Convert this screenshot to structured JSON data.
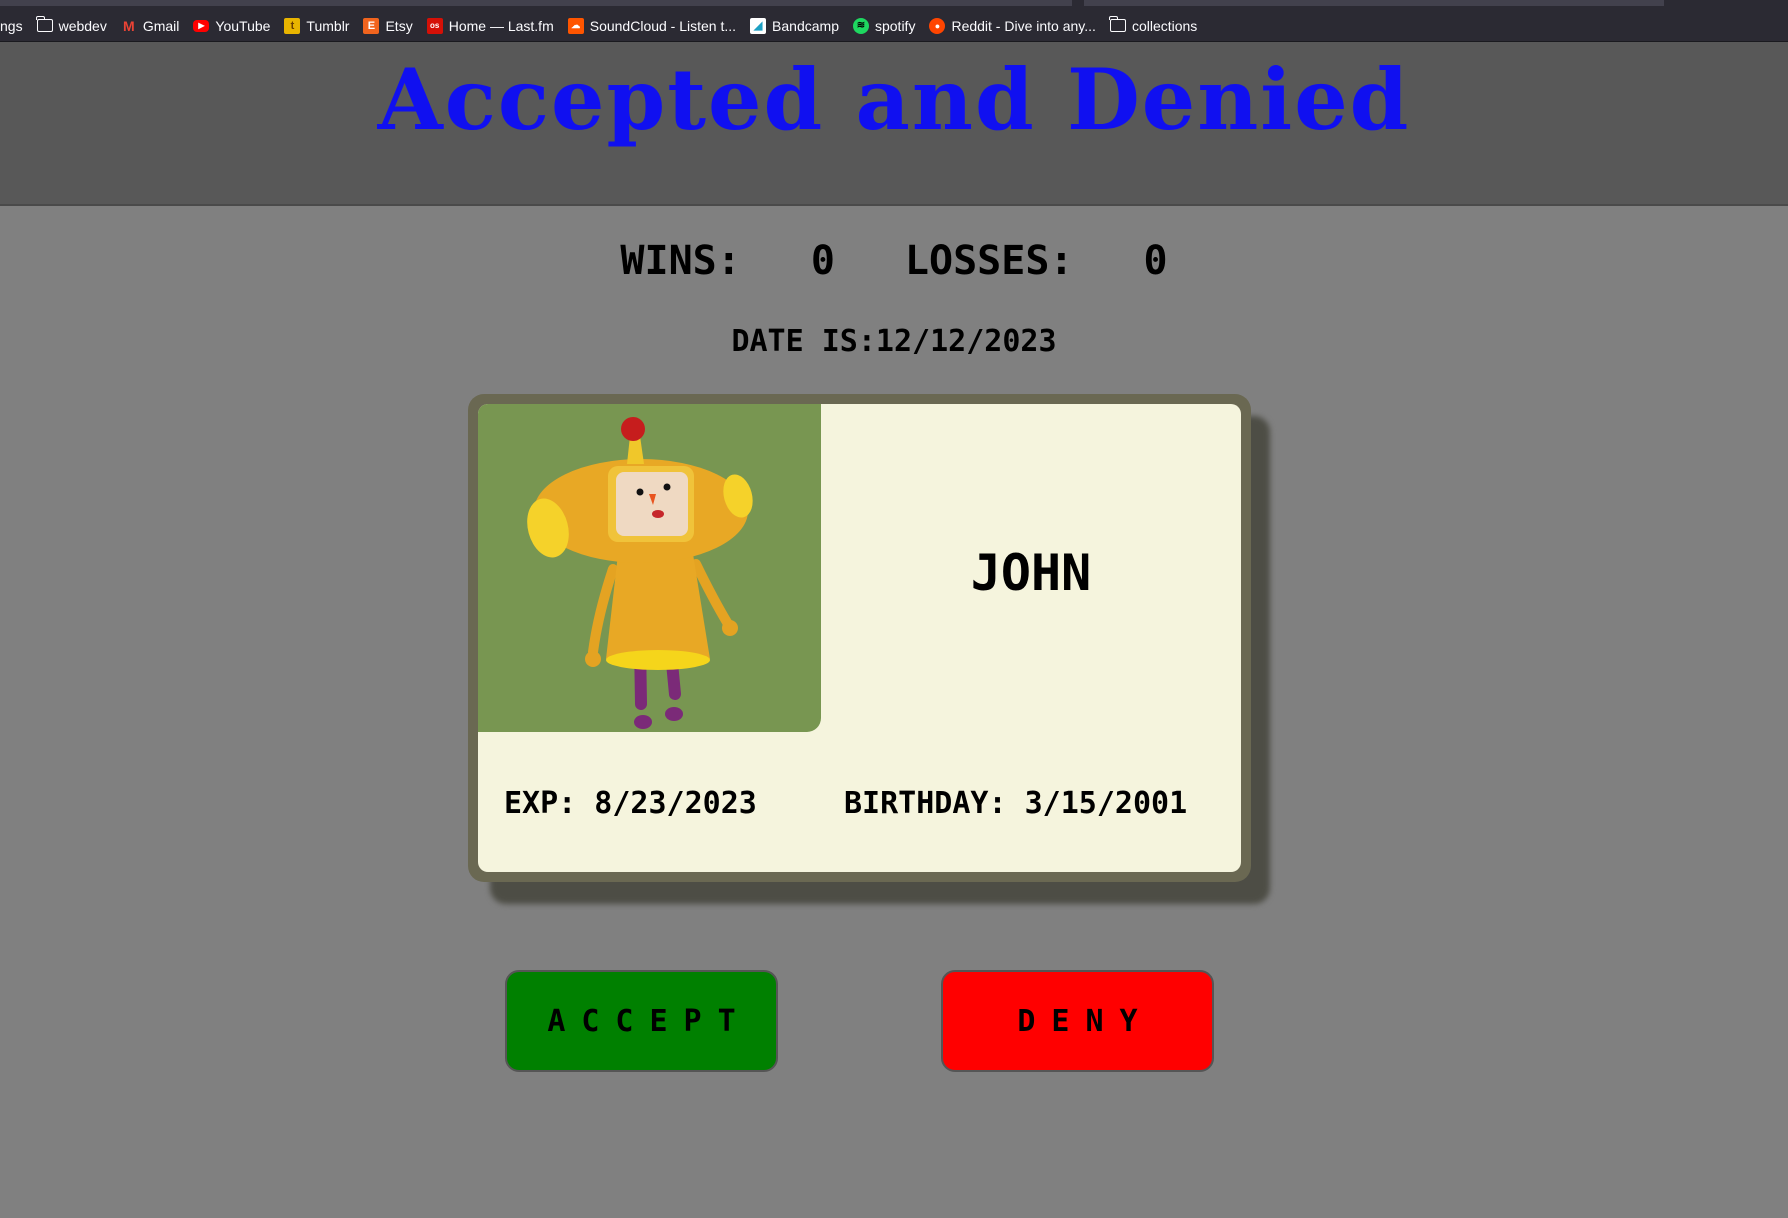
{
  "bookmarks": [
    {
      "label": "ngs",
      "icon": "none"
    },
    {
      "label": "webdev",
      "icon": "folder-icon"
    },
    {
      "label": "Gmail",
      "icon": "gmail-icon"
    },
    {
      "label": "YouTube",
      "icon": "youtube-icon"
    },
    {
      "label": "Tumblr",
      "icon": "tumblr-icon"
    },
    {
      "label": "Etsy",
      "icon": "etsy-icon"
    },
    {
      "label": "Home — Last.fm",
      "icon": "lastfm-icon"
    },
    {
      "label": "SoundCloud - Listen t...",
      "icon": "soundcloud-icon"
    },
    {
      "label": "Bandcamp",
      "icon": "bandcamp-icon"
    },
    {
      "label": "spotify",
      "icon": "spotify-icon"
    },
    {
      "label": "Reddit - Dive into any...",
      "icon": "reddit-icon"
    },
    {
      "label": "collections",
      "icon": "folder-icon"
    }
  ],
  "header": {
    "title": "Accepted and Denied",
    "title_color": "#1010f0"
  },
  "stats": {
    "wins_label": "WINS:",
    "wins_value": "0",
    "losses_label": "LOSSES:",
    "losses_value": "0"
  },
  "date_text": "DATE IS:12/12/2023",
  "card": {
    "name": "JOHN",
    "exp": "EXP: 8/23/2023",
    "birthday": "BIRTHDAY: 3/15/2001",
    "photo_icon": "katamari-prince-character"
  },
  "buttons": {
    "accept_label": "ACCEPT",
    "accept_color": "#008000",
    "deny_label": "DENY",
    "deny_color": "#ff0000"
  }
}
